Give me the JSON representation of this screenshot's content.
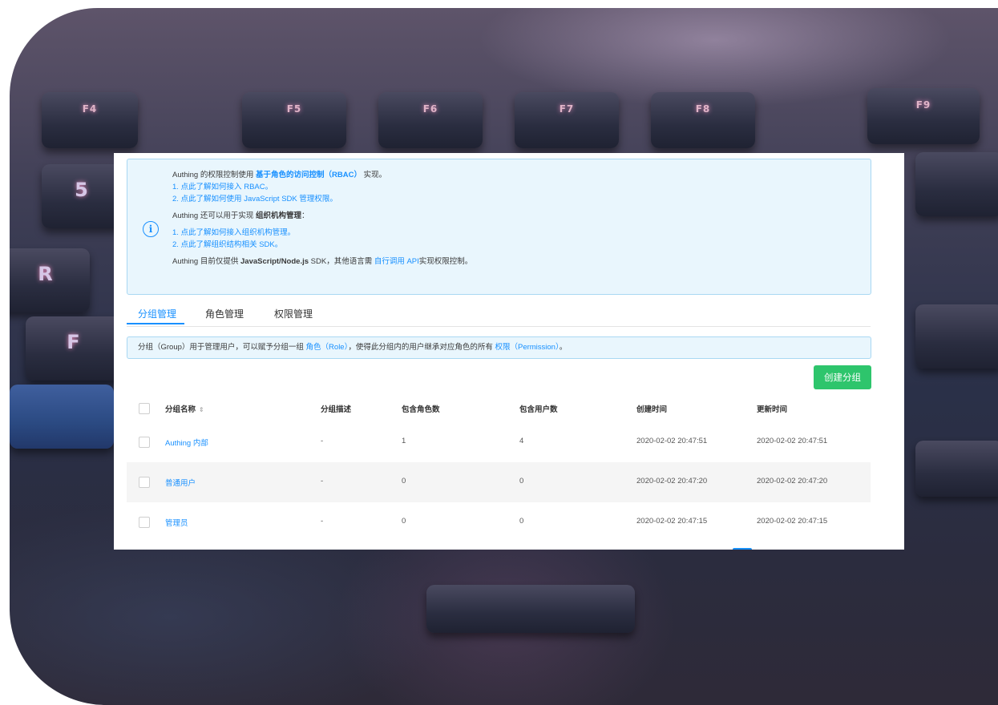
{
  "alert": {
    "line1_pre": "Authing 的权限控制使用 ",
    "line1_strong": "基于角色的访问控制（RBAC）",
    "line1_post": " 实现。",
    "line2": "1. 点此了解如何接入 RBAC。",
    "line3": "2. 点此了解如何使用 JavaScript SDK 管理权限。",
    "line4_pre": "Authing 还可以用于实现 ",
    "line4_strong": "组织机构管理",
    "line4_post": "：",
    "line5": "1. 点此了解如何接入组织机构管理。",
    "line6": "2. 点此了解组织结构相关 SDK。",
    "line7_pre": "Authing 目前仅提供 ",
    "line7_strong": "JavaScript/Node.js",
    "line7_mid": " SDK，其他语言需 ",
    "line7_link": "自行调用 API",
    "line7_post": "实现权限控制。",
    "icon": "info-circle-icon"
  },
  "tabs": [
    "分组管理",
    "角色管理",
    "权限管理"
  ],
  "info_bar": {
    "pre": "分组（Group）用于管理用户，可以赋予分组一组 ",
    "role_link": "角色（Role）",
    "mid": "，使得此分组内的用户继承对应角色的所有 ",
    "perm_link": "权限（Permission）",
    "post": "。"
  },
  "create_button": "创建分组",
  "table": {
    "headers": [
      "分组名称",
      "分组描述",
      "包含角色数",
      "包含用户数",
      "创建时间",
      "更新时间"
    ],
    "sort_icon": "sort-icon",
    "rows": [
      [
        "Authing 内部",
        "-",
        "1",
        "4",
        "2020-02-02 20:47:51",
        "2020-02-02 20:47:51"
      ],
      [
        "普通用户",
        "-",
        "0",
        "0",
        "2020-02-02 20:47:20",
        "2020-02-02 20:47:20"
      ],
      [
        "管理员",
        "-",
        "0",
        "0",
        "2020-02-02 20:47:15",
        "2020-02-02 20:47:15"
      ]
    ]
  },
  "backdrop": {
    "keys": [
      "F4",
      "F5",
      "F6",
      "F7",
      "F8",
      "F9",
      "5",
      "R",
      "F"
    ]
  },
  "colors": {
    "link": "#1890ff",
    "primary_green": "#2ec56c",
    "alert_bg": "#e9f6fd",
    "alert_border": "#a9d8f3"
  }
}
